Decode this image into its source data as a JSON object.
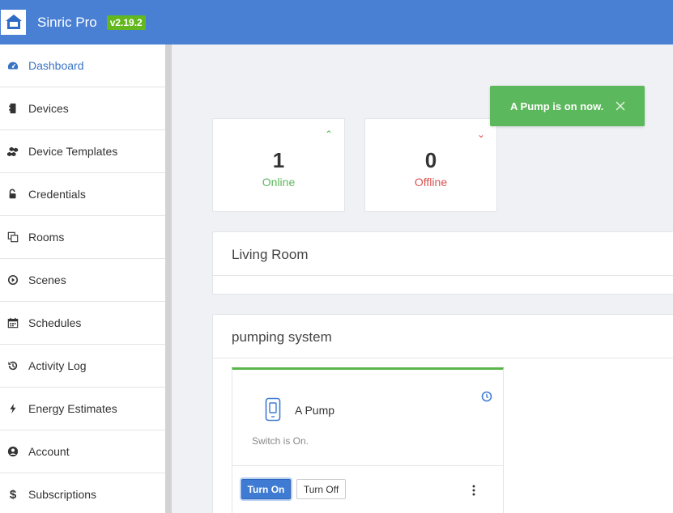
{
  "app": {
    "title": "Sinric Pro",
    "version": "v2.19.2"
  },
  "colors": {
    "header": "#4a80d4",
    "accent": "#3b73c4",
    "online": "#5cb85c",
    "offline": "#d9534f",
    "toast": "#5cb85c"
  },
  "sidebar": {
    "items": [
      {
        "label": "Dashboard",
        "icon": "dashboard-icon",
        "active": true
      },
      {
        "label": "Devices",
        "icon": "device-icon"
      },
      {
        "label": "Device Templates",
        "icon": "cubes-icon"
      },
      {
        "label": "Credentials",
        "icon": "unlock-icon"
      },
      {
        "label": "Rooms",
        "icon": "rooms-icon"
      },
      {
        "label": "Scenes",
        "icon": "play-circle-icon"
      },
      {
        "label": "Schedules",
        "icon": "calendar-icon"
      },
      {
        "label": "Activity Log",
        "icon": "history-icon"
      },
      {
        "label": "Energy Estimates",
        "icon": "bolt-icon"
      },
      {
        "label": "Account",
        "icon": "user-circle-icon"
      },
      {
        "label": "Subscriptions",
        "icon": "dollar-icon"
      }
    ]
  },
  "stats": {
    "online": {
      "count": "1",
      "label": "Online"
    },
    "offline": {
      "count": "0",
      "label": "Offline"
    }
  },
  "rooms": [
    {
      "name": "Living Room"
    },
    {
      "name": "pumping system"
    }
  ],
  "device": {
    "name": "A Pump",
    "status": "Switch is On.",
    "turn_on": "Turn On",
    "turn_off": "Turn Off"
  },
  "toast": {
    "message": "A Pump is on now."
  }
}
